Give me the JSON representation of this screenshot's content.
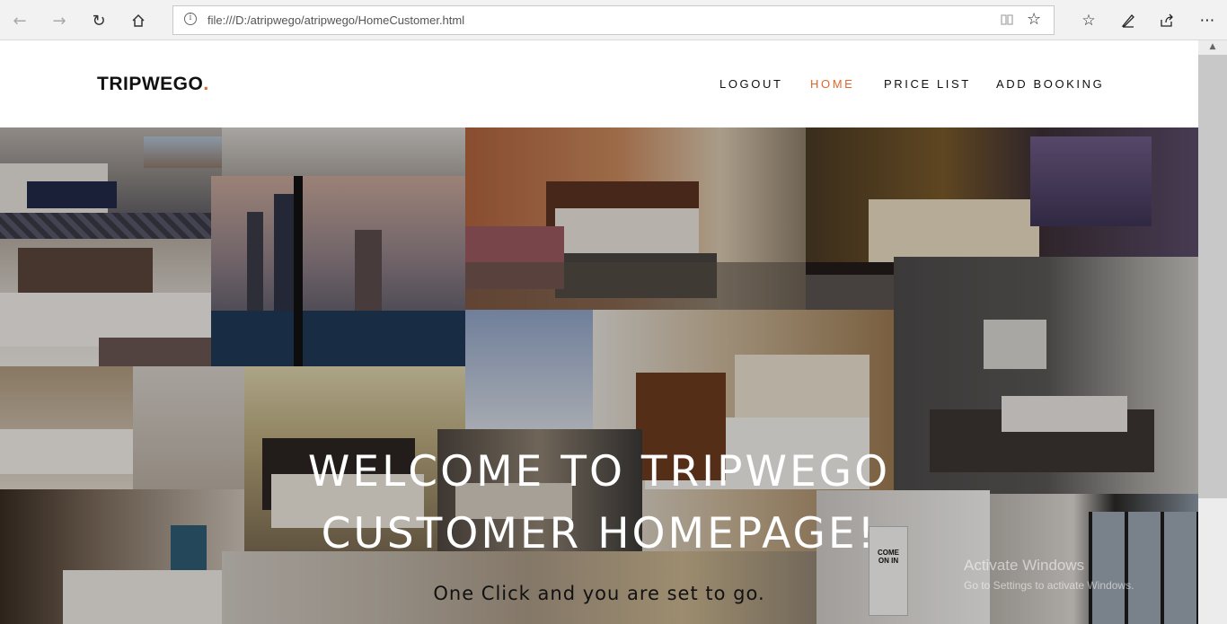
{
  "browser": {
    "url": "file:///D:/atripwego/atripwego/HomeCustomer.html",
    "icons": [
      "back-icon",
      "forward-icon",
      "refresh-icon",
      "home-icon",
      "info-icon",
      "reading-view-icon",
      "favorite-star-icon",
      "favorites-icon",
      "pen-icon",
      "share-icon",
      "more-icon"
    ]
  },
  "site": {
    "logo": "TRIPWEGO",
    "logo_dot": ".",
    "accent": "#e0662a",
    "nav": [
      "LOGOUT",
      "HOME",
      "PRICE LIST",
      "ADD BOOKING"
    ],
    "active_nav": "HOME"
  },
  "hero": {
    "title_line1": "WELCOME TO TRIPWEGO",
    "title_line2": "CUSTOMER HOMEPAGE!",
    "subtitle": "One Click and you are set to go.",
    "sign_text_1": "COME",
    "sign_text_2": "ON IN"
  },
  "watermark": {
    "line1": "Activate Windows",
    "line2": "Go to Settings to activate Windows."
  }
}
